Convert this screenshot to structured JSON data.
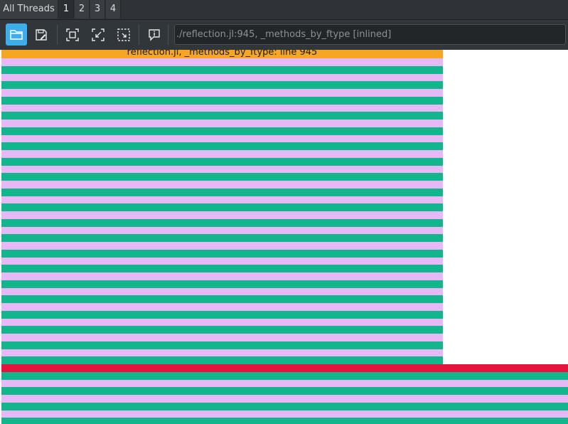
{
  "tabs": [
    {
      "label": "All Threads",
      "active": false
    },
    {
      "label": "1",
      "active": true
    },
    {
      "label": "2",
      "active": false
    },
    {
      "label": "3",
      "active": false
    },
    {
      "label": "4",
      "active": false
    }
  ],
  "toolbar": {
    "buttons": [
      {
        "name": "open-file-button",
        "icon": "folder-icon",
        "active": true
      },
      {
        "name": "save-button",
        "icon": "save-icon",
        "active": false
      },
      {
        "name": "fit-view-button",
        "icon": "fit-icon",
        "active": false
      },
      {
        "name": "shrink-view-button",
        "icon": "shrink-icon",
        "active": false
      },
      {
        "name": "select-region-button",
        "icon": "select-icon",
        "active": false
      },
      {
        "name": "info-button",
        "icon": "info-icon",
        "active": false
      }
    ],
    "path_value": "./reflection.jl:945, _methods_by_ftype [inlined]"
  },
  "flamegraph": {
    "top_frame_label": "reflection.jl, _methods_by_ftype: line 945",
    "colors": {
      "top": "#f5a623",
      "lavender": "#e6b8f5",
      "green": "#12b58c",
      "red": "#e8133c",
      "background": "#ffffff"
    }
  }
}
